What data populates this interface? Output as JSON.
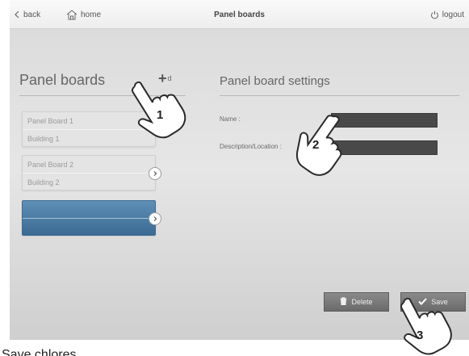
{
  "topbar": {
    "back_label": "back",
    "home_label": "home",
    "title": "Panel boards",
    "logout_label": "logout"
  },
  "left_panel": {
    "title": "Panel boards",
    "add_label": "Add",
    "add_label_visible_end": "d",
    "items": [
      {
        "name": "Panel Board 1",
        "location": "Building 1"
      },
      {
        "name": "Panel Board 2",
        "location": "Building 2"
      },
      {
        "name": "",
        "location": "",
        "selected": true
      }
    ]
  },
  "settings": {
    "title": "Panel board settings",
    "name_label": "Name :",
    "description_label": "Description/Location :",
    "name_value": "",
    "description_value": ""
  },
  "buttons": {
    "delete_label": "Delete",
    "save_label": "Save"
  },
  "callouts": [
    "1",
    "2",
    "3"
  ],
  "caption_fragment": "Save chlores",
  "colors": {
    "selected_item": "#4a7ba4",
    "field_bg": "#494949",
    "button_bg": "#777777"
  },
  "icons": [
    "chevron-left-icon",
    "home-icon",
    "power-icon",
    "plus-icon",
    "chevron-right-icon",
    "trash-icon",
    "checkmark-icon",
    "pointing-hand-icon"
  ]
}
